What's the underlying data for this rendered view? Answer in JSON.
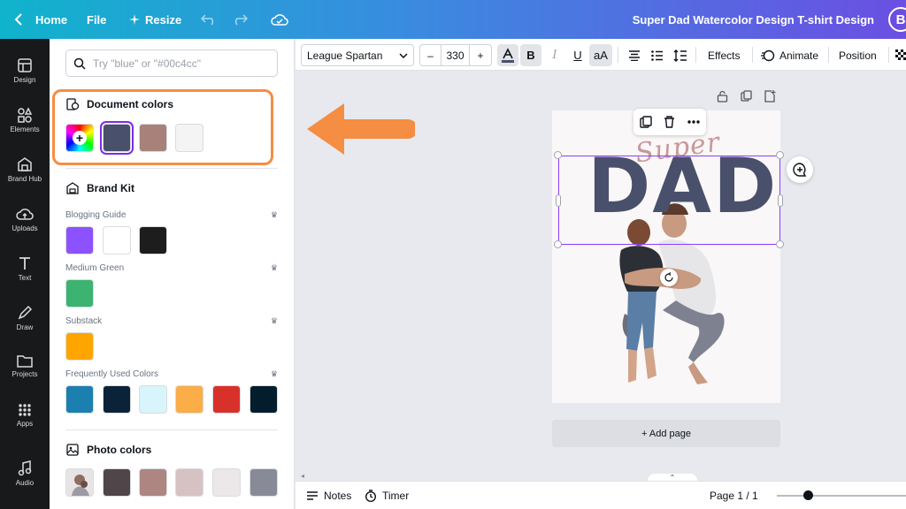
{
  "topbar": {
    "home_label": "Home",
    "file_label": "File",
    "resize_label": "Resize",
    "doc_title": "Super Dad Watercolor Design T-shirt Design",
    "avatar_letter": "B"
  },
  "rail": {
    "items": [
      {
        "label": "Design",
        "icon": "design-icon"
      },
      {
        "label": "Elements",
        "icon": "elements-icon"
      },
      {
        "label": "Brand Hub",
        "icon": "brand-hub-icon"
      },
      {
        "label": "Uploads",
        "icon": "uploads-icon"
      },
      {
        "label": "Text",
        "icon": "text-icon"
      },
      {
        "label": "Draw",
        "icon": "draw-icon"
      },
      {
        "label": "Projects",
        "icon": "projects-icon"
      },
      {
        "label": "Apps",
        "icon": "apps-icon"
      },
      {
        "label": "Audio",
        "icon": "audio-icon"
      }
    ]
  },
  "panel": {
    "search_placeholder": "Try \"blue\" or \"#00c4cc\"",
    "document_colors": {
      "title": "Document colors",
      "swatches": [
        "#49506b",
        "#a7817a",
        "#f5f4f5"
      ]
    },
    "brand_kit": {
      "title": "Brand Kit",
      "groups": [
        {
          "label": "Blogging Guide",
          "swatches": [
            "#8c52ff",
            "#ffffff",
            "#1d1d1d"
          ]
        },
        {
          "label": "Medium Green",
          "swatches": [
            "#3cb371"
          ]
        },
        {
          "label": "Substack",
          "swatches": [
            "#ffa500"
          ]
        },
        {
          "label": "Frequently Used Colors",
          "swatches": [
            "#1b7fb0",
            "#0b2338",
            "#d7f5fb",
            "#fbad48",
            "#d8312a",
            "#041d2d"
          ]
        }
      ]
    },
    "photo_colors": {
      "title": "Photo colors",
      "swatches": [
        "#504548",
        "#ad8581",
        "#d6c2c3",
        "#ece7e8",
        "#888b97"
      ]
    }
  },
  "toolbar": {
    "font_name": "League Spartan",
    "font_size": "330",
    "minus": "–",
    "plus": "+",
    "bold": "B",
    "italic": "I",
    "underline": "U",
    "case": "aA",
    "effects_label": "Effects",
    "animate_label": "Animate",
    "position_label": "Position"
  },
  "canvas": {
    "super_text": "Super",
    "dad_text": "DAD",
    "add_page_label": "+ Add page"
  },
  "bottombar": {
    "notes_label": "Notes",
    "timer_label": "Timer",
    "page_indicator": "Page 1 / 1"
  },
  "colors": {
    "accent": "#8b3dff",
    "highlight": "#f58d43"
  }
}
